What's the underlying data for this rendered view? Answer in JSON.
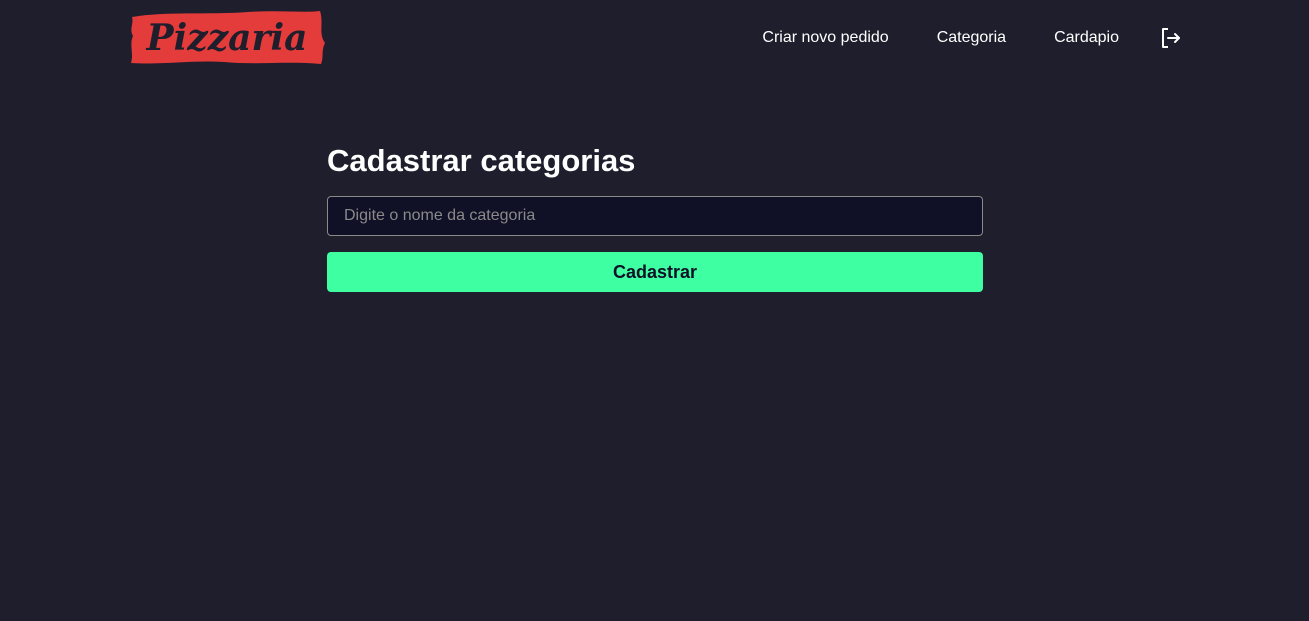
{
  "header": {
    "logo_text": "Pizzaria",
    "nav": [
      {
        "label": "Criar novo pedido"
      },
      {
        "label": "Categoria"
      },
      {
        "label": "Cardapio"
      }
    ],
    "logout_icon": "logout-icon"
  },
  "main": {
    "title": "Cadastrar categorias",
    "input_placeholder": "Digite o nome da categoria",
    "input_value": "",
    "submit_label": "Cadastrar"
  },
  "colors": {
    "background": "#1e1e2d",
    "input_background": "#101026",
    "accent": "#3fffa3",
    "logo_red": "#e43b3b"
  }
}
